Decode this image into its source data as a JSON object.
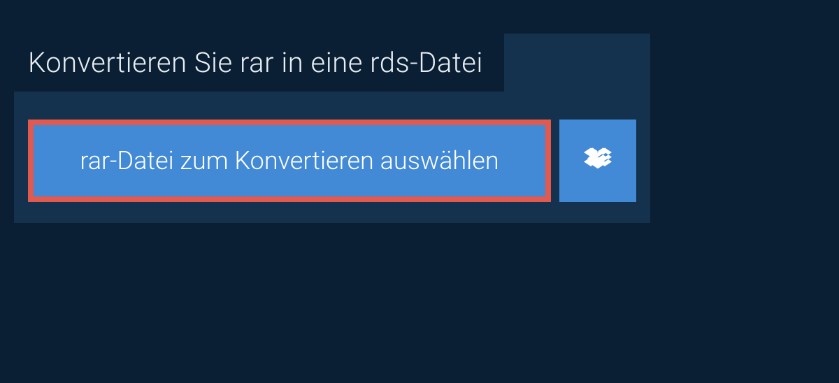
{
  "panel": {
    "title": "Konvertieren Sie rar in eine rds-Datei",
    "select_file_label": "rar-Datei zum Konvertieren auswählen"
  }
}
